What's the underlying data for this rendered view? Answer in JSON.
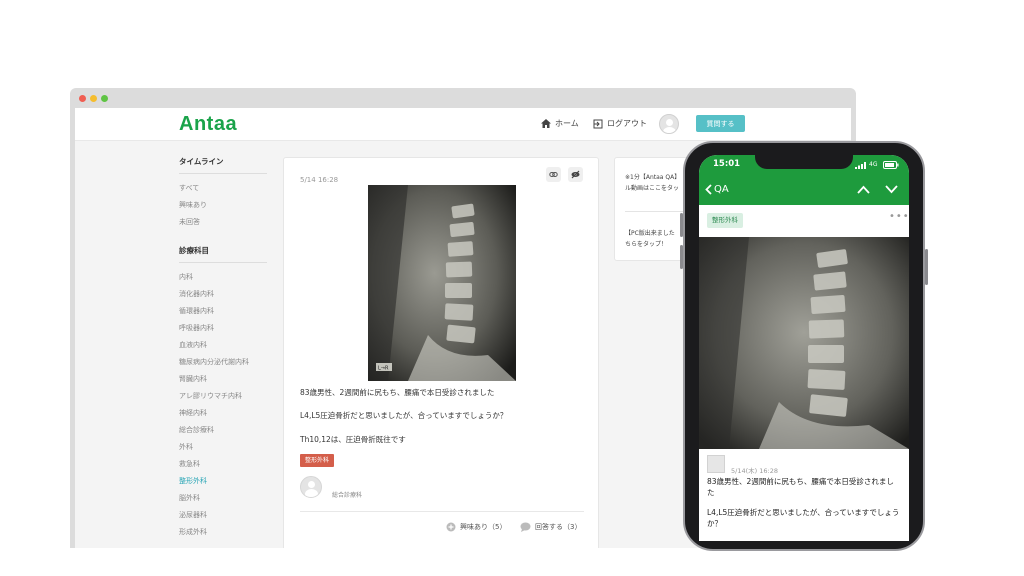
{
  "desktop": {
    "logo": "Antaa",
    "nav": {
      "home": "ホーム",
      "logout": "ログアウト",
      "ask_button": "質問する"
    },
    "sidebar": {
      "timeline_heading": "タイムライン",
      "timeline_items": [
        "すべて",
        "興味あり",
        "未回答"
      ],
      "dept_heading": "診療科目",
      "dept_items": [
        "内科",
        "消化器内科",
        "循環器内科",
        "呼吸器内科",
        "血液内科",
        "糖尿病内分泌代謝内科",
        "腎臓内科",
        "アレ膠リウマチ内科",
        "神経内科",
        "総合診療科",
        "外科",
        "救急科",
        "整形外科",
        "脳外科",
        "泌尿器科",
        "形成外科"
      ],
      "active_item": "整形外科"
    },
    "post": {
      "date": "5/14 16:28",
      "xray_marker": "L→R",
      "line1": "83歳男性、2週間前に尻もち、腰痛で本日受診されました",
      "line2": "L4,L5圧迫骨折だと思いましたが、合っていますでしょうか？",
      "line3": "Th10,12は、圧迫骨折既往です",
      "tag": "整形外科",
      "author": "総合診療科",
      "interest": "興味あり（5）",
      "answer": "回答する（3）"
    },
    "panel": {
      "line1": "※1分【Antaa QA】",
      "line2": "ル動画はここをタッ",
      "line3": "【PC版出来ました",
      "line4": "ちらをタップ！"
    }
  },
  "mobile": {
    "time": "15:01",
    "network": "4G",
    "back_label": "QA",
    "tag": "整形外科",
    "more": "•••",
    "date": "5/14(木) 16:28",
    "line1a": "83歳男性、2週間前に尻もち、腰痛で本日受診されまし",
    "line1b": "た",
    "line2a": "L4,L5圧迫骨折だと思いましたが、合っていますでしょう",
    "line2b": "か？"
  },
  "colors": {
    "brand_green": "#1aa34a",
    "appbar_green": "#1e9b3d",
    "ask_button": "#56c0c7",
    "tag_red": "#d45e4a",
    "active_link": "#2aa6b6"
  }
}
